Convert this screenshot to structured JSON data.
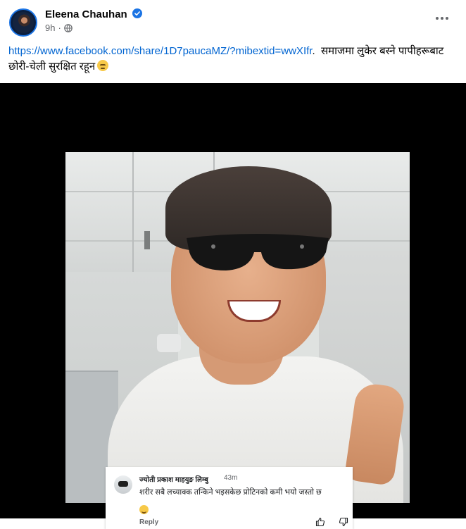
{
  "post": {
    "author": "Eleena Chauhan",
    "time": "9h",
    "separator": "·",
    "link_text": "https://www.facebook.com/share/1D7paucaMZ/?mibextid=wwXIfr",
    "link_suffix": ".",
    "caption": "समाजमा लुकेर बस्ने पापीहरूबाट छोरी-चेली सुरक्षित रहून"
  },
  "icons": {
    "verified": "verified-badge-icon",
    "audience": "globe-icon",
    "more": "more-options-icon",
    "reaction": "sad-face-emoji"
  },
  "comment": {
    "name": "ज्योती प्रकाश माहयुङ लिम्बु",
    "time": "43m",
    "text": "शरीर सबै लच्याक्क तन्किने भइसकेछ प्रोटिनको कमी भयो जस्तो छ",
    "reply": "Reply"
  },
  "colors": {
    "link": "#0064d1",
    "verified": "#1b74e4",
    "secondary_text": "#65676b",
    "media_background": "#000000"
  }
}
